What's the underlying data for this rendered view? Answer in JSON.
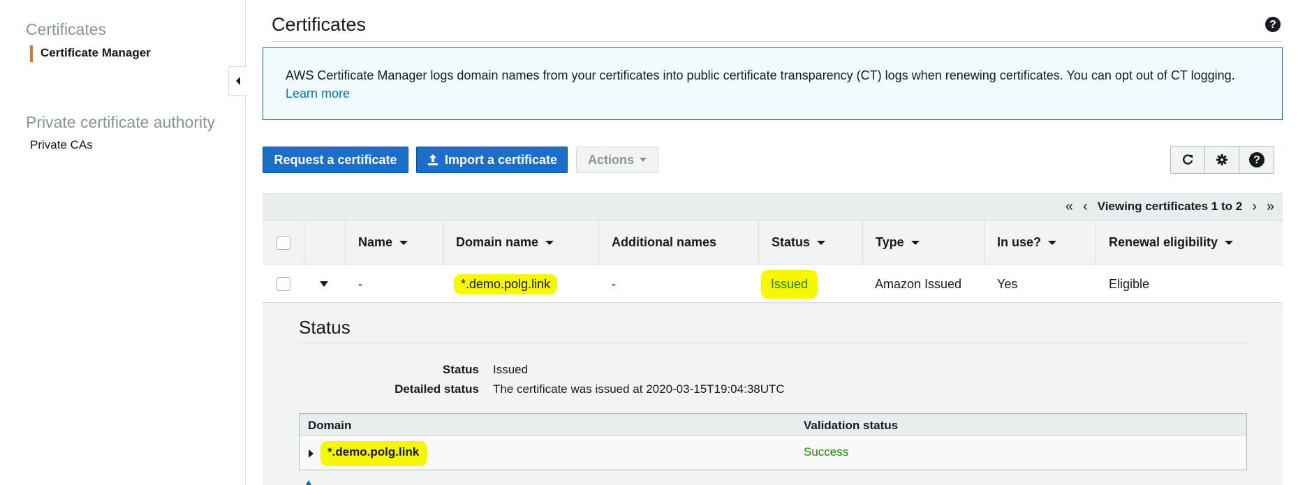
{
  "sidebar": {
    "section1_title": "Certificates",
    "section1_item": "Certificate Manager",
    "section2_title": "Private certificate authority",
    "section2_item": "Private CAs"
  },
  "header": {
    "title": "Certificates"
  },
  "info": {
    "text": "AWS Certificate Manager logs domain names from your certificates into public certificate transparency (CT) logs when renewing certificates. You can opt out of CT logging. ",
    "link": "Learn more"
  },
  "toolbar": {
    "request_label": "Request a certificate",
    "import_label": "Import a certificate",
    "actions_label": "Actions"
  },
  "pager": {
    "label": "Viewing certificates 1 to 2"
  },
  "table": {
    "columns": [
      "Name",
      "Domain name",
      "Additional names",
      "Status",
      "Type",
      "In use?",
      "Renewal eligibility"
    ],
    "row": {
      "name": "-",
      "domain": "*.demo.polg.link",
      "additional": "-",
      "status": "Issued",
      "type": "Amazon Issued",
      "in_use": "Yes",
      "renewal": "Eligible"
    }
  },
  "detail": {
    "title": "Status",
    "status_key": "Status",
    "status_val": "Issued",
    "detailed_key": "Detailed status",
    "detailed_val": "The certificate was issued at 2020-03-15T19:04:38UTC",
    "domain_col": "Domain",
    "validation_col": "Validation status",
    "domain_val": "*.demo.polg.link",
    "validation_val": "Success"
  },
  "colors": {
    "primary": "#1b6fc9",
    "accent": "#ec7211",
    "success": "#1d8102",
    "highlight": "#f7f700",
    "link": "#0073bb"
  }
}
